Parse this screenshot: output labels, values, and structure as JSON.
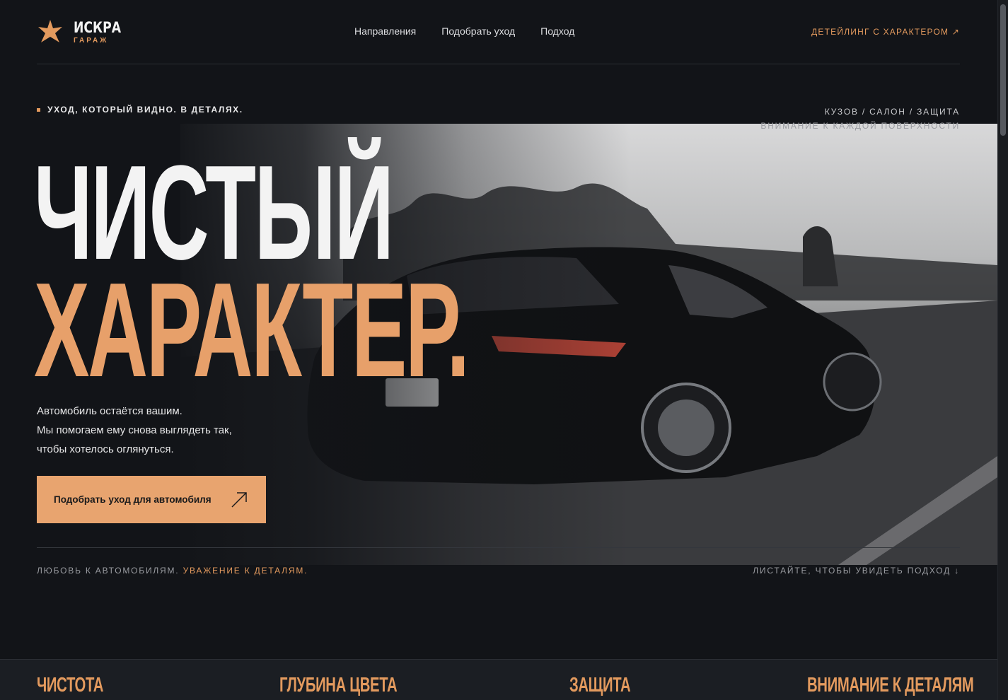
{
  "brand": {
    "name": "ИСКРА",
    "sub": "ГАРАЖ",
    "icon": "star-icon",
    "accent": "#e39a5e"
  },
  "nav": [
    {
      "label": "Направления"
    },
    {
      "label": "Подобрать уход"
    },
    {
      "label": "Подход"
    }
  ],
  "header_cta": "ДЕТЕЙЛИНГ С ХАРАКТЕРОМ ↗",
  "hero": {
    "eyebrow": "УХОД, КОТОРЫЙ ВИДНО. В ДЕТАЛЯХ.",
    "meta_line1": "КУЗОВ / САЛОН / ЗАЩИТА",
    "meta_line2": "ВНИМАНИЕ К КАЖДОЙ ПОВЕРХНОСТИ",
    "title_line1": "ЧИСТЫЙ",
    "title_line2": "ХАРАКТЕР.",
    "lead": [
      "Автомобиль остаётся вашим.",
      "Мы помогаем ему снова выглядеть так,",
      "чтобы хотелось оглянуться."
    ],
    "cta_label": "Подобрать уход для автомобиля",
    "cta_icon": "arrow-up-right-icon"
  },
  "footer_line": {
    "left_plain": "ЛЮБОВЬ К АВТОМОБИЛЯМ. ",
    "left_accent": "УВАЖЕНИЕ К ДЕТАЛЯМ.",
    "right": "ЛИСТАЙТЕ, ЧТОБЫ УВИДЕТЬ ПОДХОД ↓"
  },
  "features": [
    {
      "label": "ЧИСТОТА"
    },
    {
      "label": "ГЛУБИНА ЦВЕТА"
    },
    {
      "label": "ЗАЩИТА"
    },
    {
      "label": "ВНИМАНИЕ К ДЕТАЛЯМ"
    }
  ]
}
